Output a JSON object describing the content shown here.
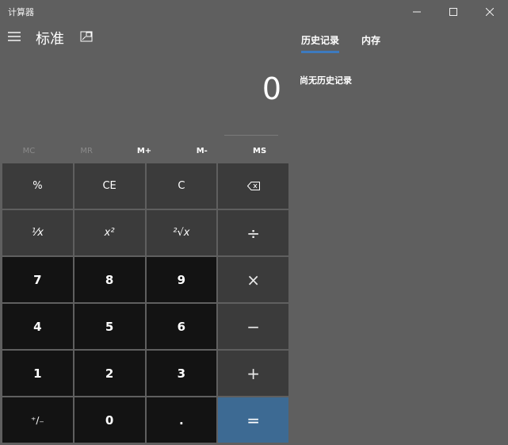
{
  "window": {
    "title": "计算器",
    "controls": [
      "minimize",
      "maximize",
      "close"
    ]
  },
  "header": {
    "mode": "标准",
    "menu_icon": "hamburger-icon",
    "keep_on_top_icon": "keep-on-top-icon"
  },
  "display": {
    "value": "0"
  },
  "memory": {
    "mc": "MC",
    "mr": "MR",
    "mplus": "M+",
    "mminus": "M-",
    "ms": "MS"
  },
  "keys": {
    "percent": "%",
    "ce": "CE",
    "c": "C",
    "backspace": "⌫",
    "reciprocal": "⅟x",
    "square": "x²",
    "sqrt": "²√x",
    "divide": "÷",
    "seven": "7",
    "eight": "8",
    "nine": "9",
    "multiply": "×",
    "four": "4",
    "five": "5",
    "six": "6",
    "minus": "−",
    "one": "1",
    "two": "2",
    "three": "3",
    "plus": "+",
    "negate": "⁺∕₋",
    "zero": "0",
    "decimal": ".",
    "equals": "="
  },
  "side_panel": {
    "tabs": [
      {
        "label": "历史记录",
        "active": true
      },
      {
        "label": "内存",
        "active": false
      }
    ],
    "empty_message": "尚无历史记录"
  },
  "colors": {
    "background": "#5f5f5f",
    "function_key": "#3b3b3b",
    "number_key": "#131313",
    "equals_key": "#3d6a93",
    "tab_accent": "#3d7abf"
  }
}
